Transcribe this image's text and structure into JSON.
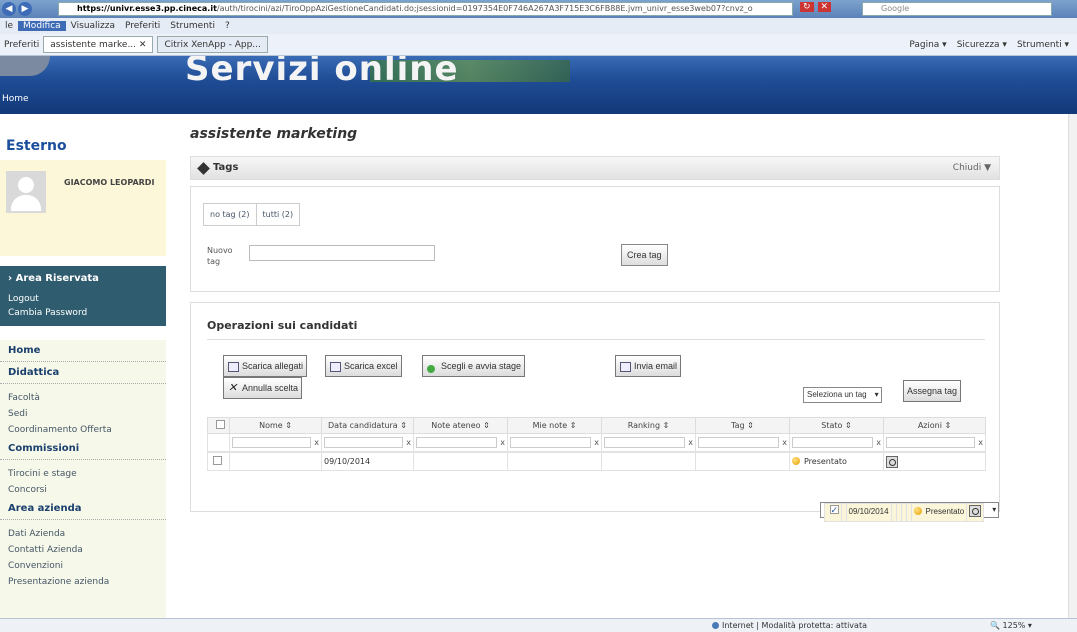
{
  "browser": {
    "url_host": "https://univr.esse3.pp.cineca.it",
    "url_path": "/auth/tirocini/azi/TiroOppAziGestioneCandidati.do;jsessionid=0197354E0F746A267A3F715E3C6FB88E.jvm_univr_esse3web07?cnvz_o",
    "search_placeholder": "Google",
    "menu": [
      "le",
      "Modifica",
      "Visualizza",
      "Preferiti",
      "Strumenti",
      "?"
    ],
    "menu_active_index": 1,
    "favorites_label": "Preferiti",
    "tabs": [
      "assistente marke...",
      "Citrix XenApp - App..."
    ],
    "tools": [
      "Pagina ▾",
      "Sicurezza ▾",
      "Strumenti ▾"
    ],
    "status_zone": "Internet | Modalità protetta: attivata",
    "zoom": "125%"
  },
  "header": {
    "banner": "Servizi online",
    "home_link": "Home"
  },
  "sidebar": {
    "role": "Esterno",
    "user_name": "GIACOMO LEOPARDI",
    "reserved": {
      "title": "Area Riservata",
      "items": [
        "Logout",
        "Cambia Password"
      ]
    },
    "sections": [
      {
        "title": "Home",
        "items": []
      },
      {
        "title": "Didattica",
        "items": [
          "Facoltà",
          "Sedi",
          "Coordinamento Offerta"
        ]
      },
      {
        "title": "Commissioni",
        "items": [
          "Tirocini e stage",
          "Concorsi"
        ]
      },
      {
        "title": "Area azienda",
        "items": [
          "Dati Azienda",
          "Contatti Azienda",
          "Convenzioni",
          "Presentazione azienda"
        ]
      }
    ]
  },
  "main": {
    "title": "assistente marketing",
    "tags_panel": {
      "label": "Tags",
      "close_label": "Chiudi ▼",
      "pills": [
        "no tag (2)",
        "tutti (2)"
      ],
      "new_tag_label": "Nuovo tag",
      "new_tag_value": "",
      "create_button": "Crea tag"
    },
    "ops": {
      "title": "Operazioni sui candidati",
      "buttons": {
        "scarica_allegati": "Scarica allegati",
        "scarica_excel": "Scarica excel",
        "scegli_stage": "Scegli e avvia stage",
        "invia_email": "Invia email",
        "annulla_scelta": "Annulla scelta",
        "assegna_tag": "Assegna tag"
      },
      "tag_select_value": "Seleziona un tag"
    },
    "table": {
      "columns": [
        "Nome",
        "Data candidatura",
        "Note ateneo",
        "Mie note",
        "Ranking",
        "Tag",
        "Stato",
        "Azioni"
      ],
      "rows": [
        {
          "checked": true,
          "nome": "",
          "data": "09/10/2014",
          "note_ateneo": "",
          "mie_note": "",
          "ranking": "",
          "tag": "",
          "stato": "Presentato"
        },
        {
          "checked": false,
          "nome": "",
          "data": "09/10/2014",
          "note_ateneo": "",
          "mie_note": "",
          "ranking": "",
          "tag": "",
          "stato": "Presentato"
        }
      ]
    }
  }
}
